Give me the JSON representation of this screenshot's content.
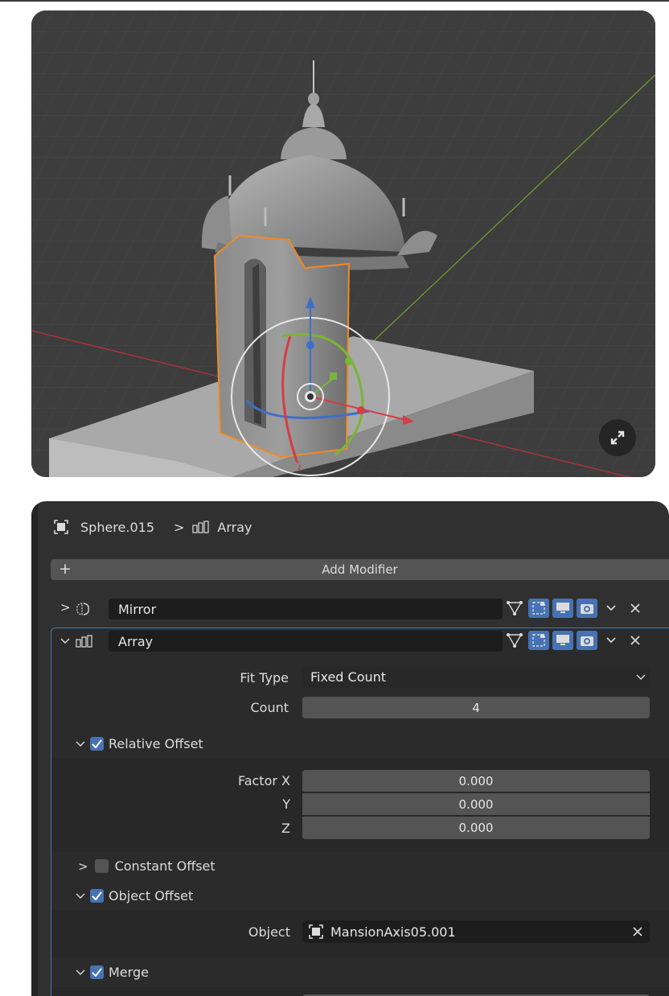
{
  "header": {
    "object_name": "Sphere.015",
    "separator": ">",
    "modifier_name": "Array"
  },
  "add_modifier": {
    "plus": "+",
    "label": "Add Modifier"
  },
  "modifiers": [
    {
      "name": "Mirror",
      "expanded": false
    },
    {
      "name": "Array",
      "expanded": true
    }
  ],
  "array": {
    "fit_type_label": "Fit Type",
    "fit_type_value": "Fixed Count",
    "count_label": "Count",
    "count_value": "4",
    "relative_offset_label": "Relative Offset",
    "factor_x_label": "Factor X",
    "factor_y_label": "Y",
    "factor_z_label": "Z",
    "factor_x": "0.000",
    "factor_y": "0.000",
    "factor_z": "0.000",
    "constant_offset_label": "Constant Offset",
    "object_offset_label": "Object Offset",
    "object_label": "Object",
    "object_value": "MansionAxis05.001",
    "merge_label": "Merge"
  },
  "colors": {
    "accent": "#4772b3",
    "selection_outline": "#f08a24",
    "x_axis": "#c8363f",
    "y_axis": "#7ab535"
  }
}
